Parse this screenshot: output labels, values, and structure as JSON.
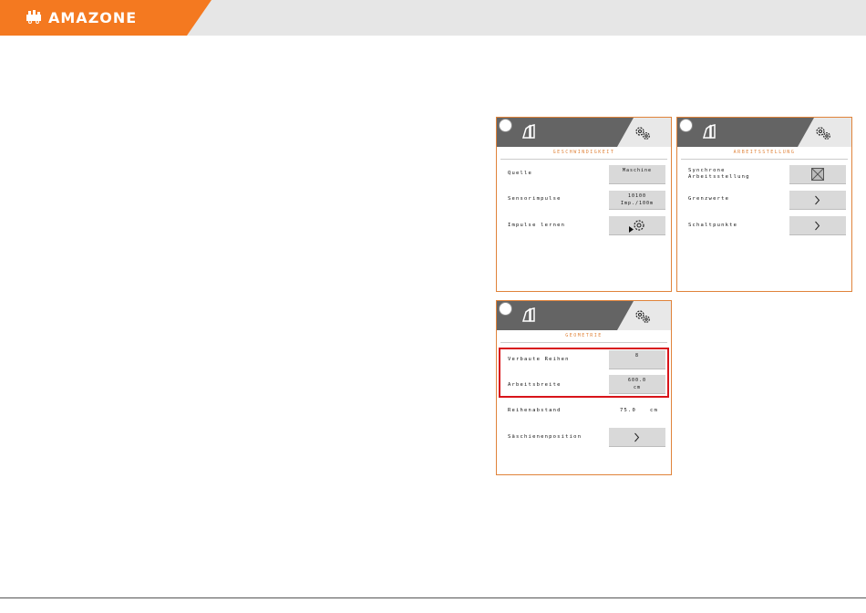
{
  "brand": {
    "name": "AMAZONE"
  },
  "colors": {
    "brand_orange": "#f47920",
    "screen_border": "#e0833a",
    "highlight_red": "#d8141a"
  },
  "screens": {
    "speed": {
      "title": "GESCHWINDIGKEIT",
      "rows": [
        {
          "label": "Quelle",
          "button": [
            "Maschine",
            ""
          ]
        },
        {
          "label": "Sensorimpulse",
          "button": [
            "10100",
            "Imp./100m"
          ]
        },
        {
          "label": "Impulse lernen",
          "button_icon": "play-gear-icon"
        }
      ]
    },
    "work_position": {
      "title": "ARBEITSSTELLUNG",
      "rows": [
        {
          "label": "Synchrone\nArbeitsstellung",
          "button_icon": "checkbox-x-icon"
        },
        {
          "label": "Grenzwerte",
          "button_icon": "chevron-right-icon"
        },
        {
          "label": "Schaltpunkte",
          "button_icon": "chevron-right-icon"
        }
      ]
    },
    "geometry": {
      "title": "GEOMETRIE",
      "rows": [
        {
          "label": "Verbaute Reihen",
          "button": [
            "8",
            ""
          ]
        },
        {
          "label": "Arbeitsbreite",
          "button": [
            "600.0",
            "cm"
          ]
        },
        {
          "label": "Reihenabstand",
          "value": "75.0",
          "unit": "cm"
        },
        {
          "label": "Säschienenposition",
          "button_icon": "chevron-right-icon"
        }
      ]
    }
  }
}
